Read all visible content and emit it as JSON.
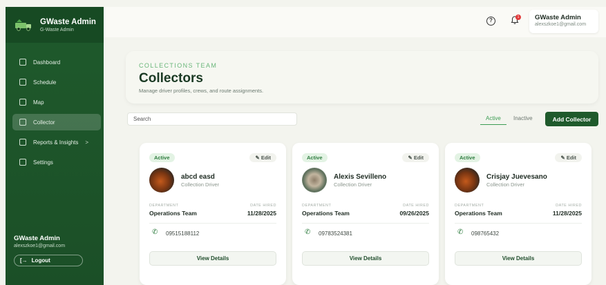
{
  "sidebar": {
    "brand_title": "GWaste Admin",
    "brand_subtitle": "G-Waste Admin",
    "items": [
      {
        "label": "Dashboard",
        "icon": "dashboard-icon",
        "active": false
      },
      {
        "label": "Schedule",
        "icon": "calendar-icon",
        "active": false
      },
      {
        "label": "Map",
        "icon": "map-icon",
        "active": false
      },
      {
        "label": "Collector",
        "icon": "collector-icon",
        "active": true
      },
      {
        "label": "Reports & Insights",
        "icon": "report-icon",
        "active": false,
        "chevron": ">"
      },
      {
        "label": "Settings",
        "icon": "gear-icon",
        "active": false
      }
    ],
    "user_name": "GWaste Admin",
    "user_email": "alexszkoe1@gmail.com",
    "logout_label": "Logout"
  },
  "topbar": {
    "notification_count": "1",
    "user_name": "GWaste Admin",
    "user_email": "alexszkoe1@gmail.com"
  },
  "header": {
    "eyebrow": "COLLECTIONS TEAM",
    "title": "Collectors",
    "subtitle": "Manage driver profiles, crews, and route assignments."
  },
  "controls": {
    "search_placeholder": "Search",
    "tab_active": "Active",
    "tab_inactive": "Inactive",
    "add_label": "Add Collector"
  },
  "cards": [
    {
      "status": "Active",
      "edit": "Edit",
      "name": "abcd easd",
      "role": "Collection Driver",
      "dept_label": "DEPARTMENT",
      "dept": "Operations Team",
      "date_label": "DATE HIRED",
      "date": "11/28/2025",
      "phone": "09515188112",
      "view": "View Details"
    },
    {
      "status": "Active",
      "edit": "Edit",
      "name": "Alexis Sevilleno",
      "role": "Collection Driver",
      "dept_label": "DEPARTMENT",
      "dept": "Operations Team",
      "date_label": "DATE HIRED",
      "date": "09/26/2025",
      "phone": "09783524381",
      "view": "View Details"
    },
    {
      "status": "Active",
      "edit": "Edit",
      "name": "Crisjay Juevesano",
      "role": "Collection Driver",
      "dept_label": "DEPARTMENT",
      "dept": "Operations Team",
      "date_label": "DATE HIRED",
      "date": "11/28/2025",
      "phone": "098765432",
      "view": "View Details"
    }
  ],
  "colors": {
    "sidebar": "#1f5a2c",
    "accent": "#3b9c52",
    "badge_bg": "#e3f3e4",
    "notification": "#e23b3b"
  }
}
